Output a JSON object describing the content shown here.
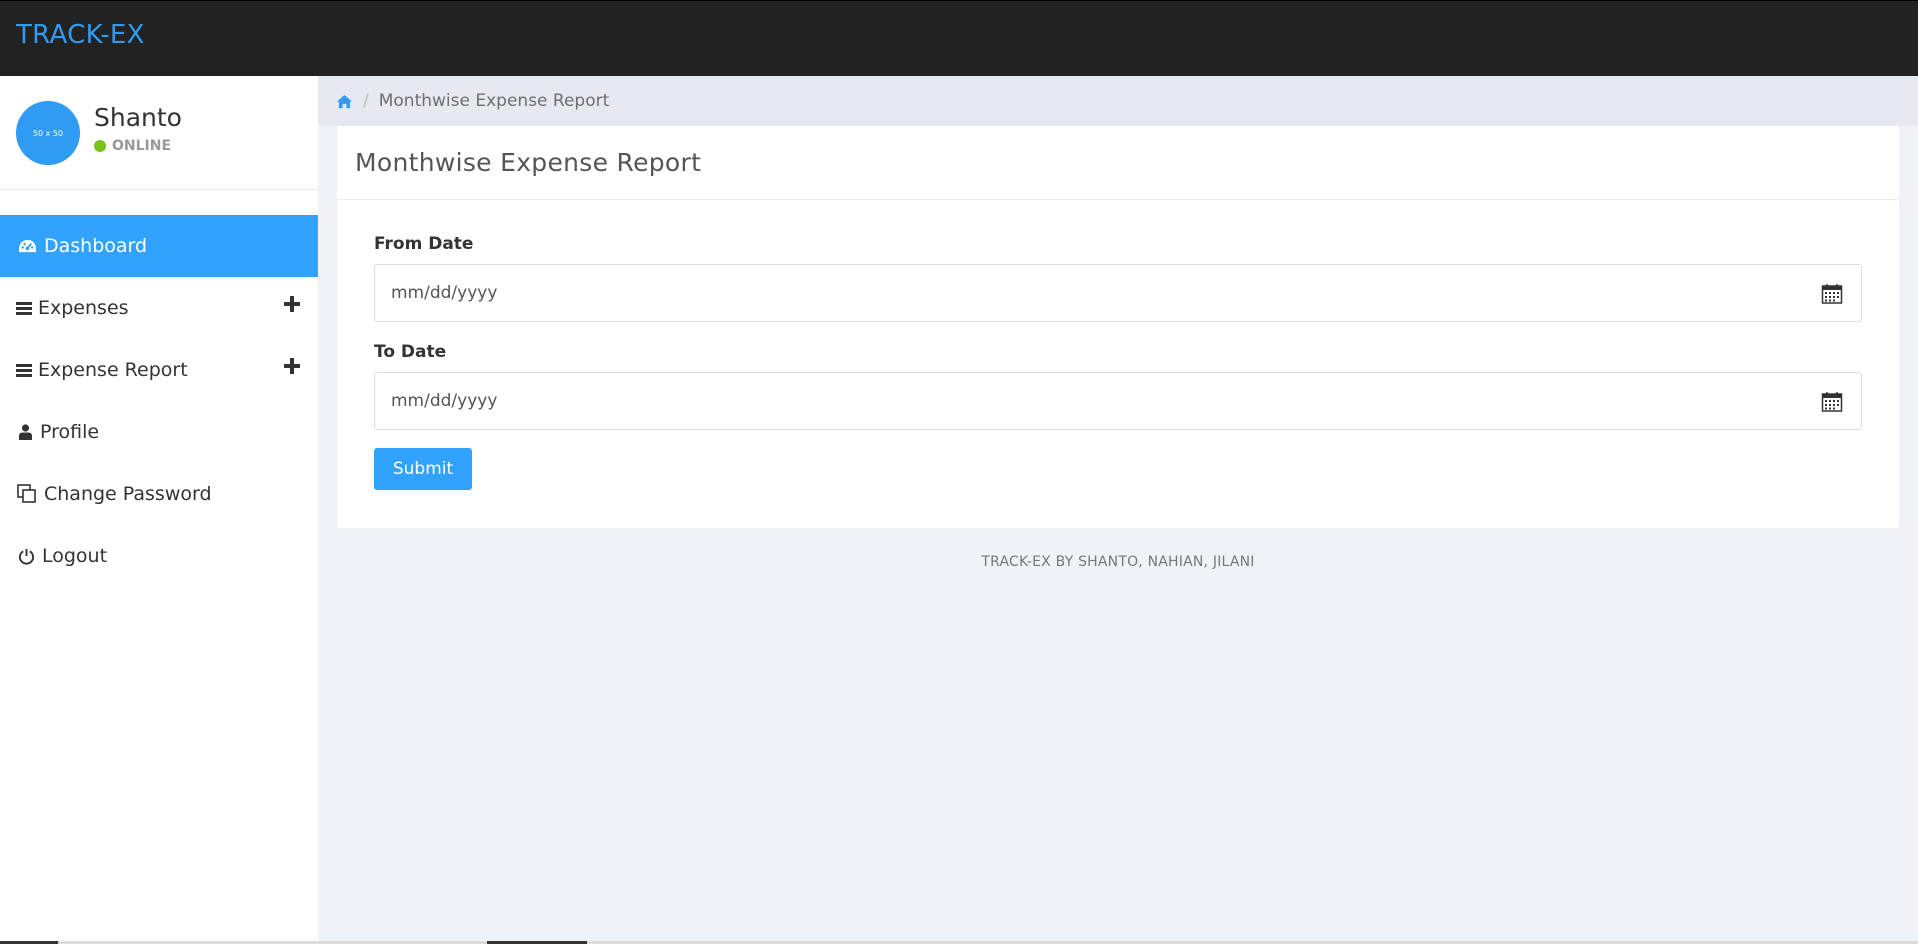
{
  "brand": "TRACK-EX",
  "user": {
    "avatar_text": "50 x 50",
    "name": "Shanto",
    "status": "ONLINE"
  },
  "nav": [
    {
      "label": "Dashboard",
      "icon": "dashboard-icon",
      "active": true
    },
    {
      "label": "Expenses",
      "icon": "bars-icon",
      "expandable": true
    },
    {
      "label": "Expense Report",
      "icon": "bars-icon",
      "expandable": true
    },
    {
      "label": "Profile",
      "icon": "user-icon"
    },
    {
      "label": "Change Password",
      "icon": "copy-icon"
    },
    {
      "label": "Logout",
      "icon": "power-icon"
    }
  ],
  "breadcrumb": {
    "home_icon": "home-icon",
    "separator": "/",
    "current": "Monthwise Expense Report"
  },
  "card": {
    "title": "Monthwise Expense Report",
    "from_label": "From Date",
    "from_placeholder": "mm/dd/yyyy",
    "to_label": "To Date",
    "to_placeholder": "mm/dd/yyyy",
    "submit_label": "Submit"
  },
  "footer": "TRACK-EX BY SHANTO, NAHIAN, JILANI",
  "colors": {
    "accent": "#31a3ff",
    "brand": "#2f9bf2",
    "topbar": "#222222",
    "online": "#7ac21a"
  }
}
